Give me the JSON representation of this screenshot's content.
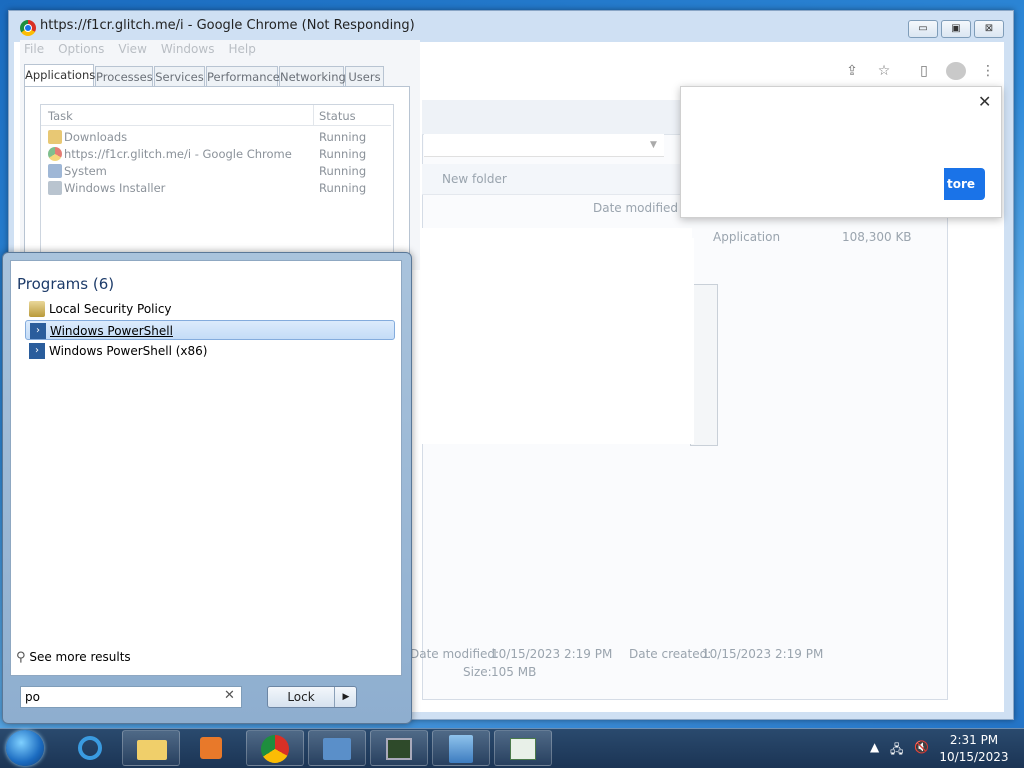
{
  "chrome": {
    "title": "https://f1cr.glitch.me/i - Google Chrome (Not Responding)",
    "caption_minimize": "▭",
    "caption_maximize": "▣",
    "caption_close": "⊠"
  },
  "popup": {
    "close_glyph": "✕",
    "button_label": "tore"
  },
  "explorer": {
    "new_folder": "New folder",
    "col_date_modified": "Date modified",
    "row_type": "Application",
    "row_size": "108,300 KB",
    "details_modified_label": "Date modified:",
    "details_modified_value": "10/15/2023 2:19 PM",
    "details_created_label": "Date created:",
    "details_created_value": "10/15/2023 2:19 PM",
    "details_size_label": "Size:",
    "details_size_value": "105 MB"
  },
  "task_manager": {
    "menu": [
      "File",
      "Options",
      "View",
      "Windows",
      "Help"
    ],
    "tabs": [
      "Applications",
      "Processes",
      "Services",
      "Performance",
      "Networking",
      "Users"
    ],
    "active_tab": "Applications",
    "columns": {
      "task": "Task",
      "status": "Status"
    },
    "rows": [
      {
        "task": "Downloads",
        "status": "Running",
        "icon": "folder-icon"
      },
      {
        "task": "https://f1cr.glitch.me/i - Google Chrome",
        "status": "Running",
        "icon": "chrome-icon"
      },
      {
        "task": "System",
        "status": "Running",
        "icon": "system-icon"
      },
      {
        "task": "Windows Installer",
        "status": "Running",
        "icon": "installer-icon"
      }
    ]
  },
  "start_menu": {
    "heading": "Programs (6)",
    "items": [
      {
        "label": "Local Security Policy",
        "icon": "security-policy-icon",
        "selected": false
      },
      {
        "label": "Windows PowerShell",
        "icon": "powershell-icon",
        "selected": true
      },
      {
        "label": "Windows PowerShell (x86)",
        "icon": "powershell-icon",
        "selected": false
      }
    ],
    "see_more": "See more results",
    "search_value": "po",
    "clear_glyph": "✕",
    "lock_label": "Lock",
    "lock_arrow": "▶"
  },
  "taskbar": {
    "apps": [
      "internet-explorer-icon",
      "file-explorer-icon",
      "media-player-icon",
      "chrome-icon",
      "control-panel-icon",
      "task-manager-icon",
      "network-setup-icon",
      "installer-window-icon"
    ],
    "time": "2:31 PM",
    "date": "10/15/2023"
  }
}
